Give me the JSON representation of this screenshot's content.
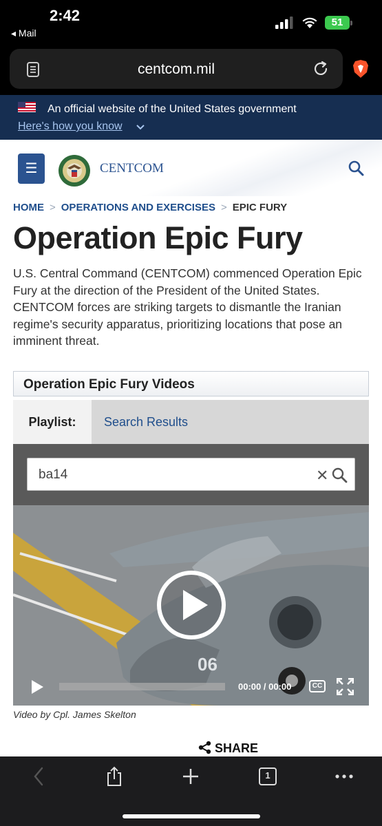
{
  "status_bar": {
    "time": "2:42",
    "back_app": "◂ Mail",
    "battery": "51"
  },
  "browser": {
    "url": "centcom.mil"
  },
  "gov_banner": {
    "text": "An official website of the United States government",
    "link": "Here's how you know"
  },
  "header": {
    "site_name": "CENTCOM",
    "menu_glyph": "☰"
  },
  "breadcrumb": {
    "home": "HOME",
    "section": "OPERATIONS AND EXERCISES",
    "current": "EPIC FURY",
    "separator": ">"
  },
  "page": {
    "title": "Operation Epic Fury",
    "intro": "U.S. Central Command (CENTCOM) commenced Operation Epic Fury at the direction of the President of the United States. CENTCOM forces are striking targets to dismantle the Iranian regime's security apparatus, prioritizing locations that pose an imminent threat."
  },
  "video_panel": {
    "heading": "Operation Epic Fury Videos",
    "tab_playlist": "Playlist:",
    "tab_search": "Search Results",
    "search_value": "ba14",
    "clear_glyph": "✕",
    "time": "00:00 / 00:00",
    "cc_label": "CC",
    "progress": 0
  },
  "caption": "Video by Cpl. James Skelton",
  "share_label": "SHARE",
  "toolbar": {
    "tabs_count": "1"
  },
  "colors": {
    "navy": "#162e51",
    "link_blue": "#1f4e8c",
    "menu_blue": "#2b5390",
    "battery_green": "#3cc94f"
  }
}
